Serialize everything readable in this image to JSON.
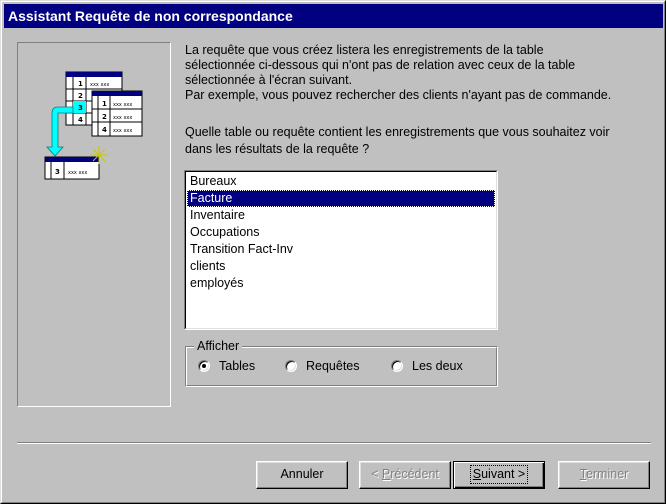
{
  "window": {
    "title": "Assistant Requête de non correspondance"
  },
  "illustration": {
    "icon": "table-join-wizard-icon",
    "back_table_rows": [
      "1",
      "2",
      "3",
      "4"
    ],
    "front_table_rows": [
      "1",
      "2",
      "4"
    ],
    "result_row": "3",
    "placeholder_text": "xxx xxx"
  },
  "instructions": {
    "text": "La requête que vous créez listera les enregistrements de la table\nsélectionnée ci-dessous qui n'ont pas de relation avec ceux de la table\nsélectionnée à l'écran suivant.\nPar exemple, vous pouvez rechercher des clients n'ayant pas de commande."
  },
  "question": {
    "text": "Quelle table ou requête contient les enregistrements que vous souhaitez voir\ndans les résultats de la requête ?"
  },
  "table_list": {
    "items": [
      "Bureaux",
      "Facture",
      "Inventaire",
      "Occupations",
      "Transition Fact-Inv",
      "clients",
      "employés"
    ],
    "selected": "Facture"
  },
  "view_group": {
    "label": "Afficher",
    "options": [
      "Tables",
      "Requêtes",
      "Les deux"
    ],
    "selected": "Tables"
  },
  "buttons": {
    "cancel": "Annuler",
    "previous_accel": "P",
    "previous_rest": "récédent",
    "previous_prefix": "< ",
    "next_accel": "S",
    "next_rest": "uivant",
    "next_suffix": " >",
    "finish_accel": "T",
    "finish_rest": "erminer"
  },
  "colors": {
    "face": "#c0c0c0",
    "title_bar": "#000080",
    "selection": "#000080",
    "arrow": "#00ffff"
  }
}
